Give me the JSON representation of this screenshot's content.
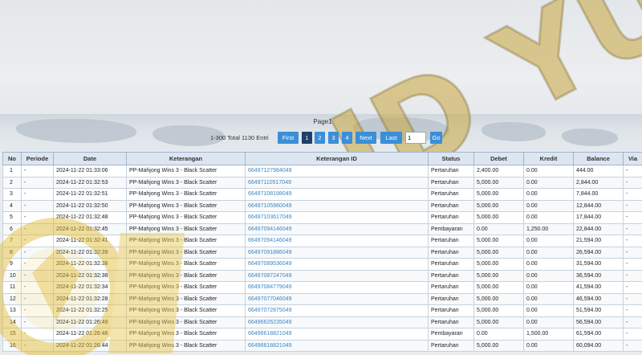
{
  "pager": {
    "caption": "Page1",
    "total": "1-300 Total 1130 Entri",
    "first": "First",
    "pages": [
      "1",
      "2",
      "3",
      "4"
    ],
    "current_page": "1",
    "next": "Next",
    "last": "Last",
    "page_input": "1",
    "go": "Go"
  },
  "table": {
    "headers": [
      "No",
      "Periode",
      "Date",
      "Keterangan",
      "Keterangan ID",
      "Status",
      "Debet",
      "Kredit",
      "Balance",
      "Via"
    ],
    "rows": [
      [
        "1",
        "-",
        "2024-11-22 01:33:06",
        "PP-Mahjong Wins 3 - Black Scatter",
        "66497127984049",
        "Pertaruhan",
        "2,400.00",
        "0.00",
        "444.00",
        "-"
      ],
      [
        "2",
        "-",
        "2024-11-22 01:32:53",
        "PP-Mahjong Wins 3 - Black Scatter",
        "66497110517049",
        "Pertaruhan",
        "5,000.00",
        "0.00",
        "2,844.00",
        "-"
      ],
      [
        "3",
        "-",
        "2024-11-22 01:32:51",
        "PP-Mahjong Wins 3 - Black Scatter",
        "66497108198049",
        "Pertaruhan",
        "5,000.00",
        "0.00",
        "7,844.00",
        "-"
      ],
      [
        "4",
        "-",
        "2024-11-22 01:32:50",
        "PP-Mahjong Wins 3 - Black Scatter",
        "66497105960049",
        "Pertaruhan",
        "5,000.00",
        "0.00",
        "12,844.00",
        "-"
      ],
      [
        "5",
        "-",
        "2024-11-22 01:32:48",
        "PP-Mahjong Wins 3 - Black Scatter",
        "66497103617049",
        "Pertaruhan",
        "5,000.00",
        "0.00",
        "17,844.00",
        "-"
      ],
      [
        "6",
        "-",
        "2024-11-22 01:32:45",
        "PP-Mahjong Wins 3 - Black Scatter",
        "66497094146049",
        "Pembayaran",
        "0.00",
        "1,250.00",
        "22,844.00",
        "-"
      ],
      [
        "7",
        "-",
        "2024-11-22 01:32:41",
        "PP-Mahjong Wins 3 - Black Scatter",
        "66497094146049",
        "Pertaruhan",
        "5,000.00",
        "0.00",
        "21,594.00",
        "-"
      ],
      [
        "8",
        "-",
        "2024-11-22 01:32:39",
        "PP-Mahjong Wins 3 - Black Scatter",
        "66497091886049",
        "Pertaruhan",
        "5,000.00",
        "0.00",
        "26,594.00",
        "-"
      ],
      [
        "9",
        "-",
        "2024-11-22 01:32:38",
        "PP-Mahjong Wins 3 - Black Scatter",
        "66497089536049",
        "Pertaruhan",
        "5,000.00",
        "0.00",
        "31,594.00",
        "-"
      ],
      [
        "10",
        "-",
        "2024-11-22 01:32:36",
        "PP-Mahjong Wins 3 - Black Scatter",
        "66497087247049",
        "Pertaruhan",
        "5,000.00",
        "0.00",
        "36,594.00",
        "-"
      ],
      [
        "11",
        "-",
        "2024-11-22 01:32:34",
        "PP-Mahjong Wins 3 - Black Scatter",
        "66497084779049",
        "Pertaruhan",
        "5,000.00",
        "0.00",
        "41,594.00",
        "-"
      ],
      [
        "12",
        "-",
        "2024-11-22 01:32:28",
        "PP-Mahjong Wins 3 - Black Scatter",
        "66497077046049",
        "Pertaruhan",
        "5,000.00",
        "0.00",
        "46,594.00",
        "-"
      ],
      [
        "13",
        "-",
        "2024-11-22 01:32:25",
        "PP-Mahjong Wins 3 - Black Scatter",
        "66497072875049",
        "Pertaruhan",
        "5,000.00",
        "0.00",
        "51,594.00",
        "-"
      ],
      [
        "14",
        "-",
        "2024-11-22 01:26:49",
        "PP-Mahjong Wins 3 - Black Scatter",
        "66496626235049",
        "Pertaruhan",
        "5,000.00",
        "0.00",
        "56,594.00",
        "-"
      ],
      [
        "15",
        "-",
        "2024-11-22 01:26:46",
        "PP-Mahjong Wins 3 - Black Scatter",
        "66496618821049",
        "Pembayaran",
        "0.00",
        "1,500.00",
        "61,594.00",
        "-"
      ],
      [
        "16",
        "-",
        "2024-11-22 01:26:44",
        "PP-Mahjong Wins 3 - Black Scatter",
        "66496618821049",
        "Pertaruhan",
        "5,000.00",
        "0.00",
        "60,094.00",
        "-"
      ]
    ]
  },
  "watermark": {
    "text": "ID YUK",
    "color": "#d9b94a"
  },
  "colors": {
    "button_blue": "#3a8fd8",
    "button_active": "#1e3f6b",
    "link_blue": "#3a87c8",
    "header_bg": "#dde6f0"
  }
}
